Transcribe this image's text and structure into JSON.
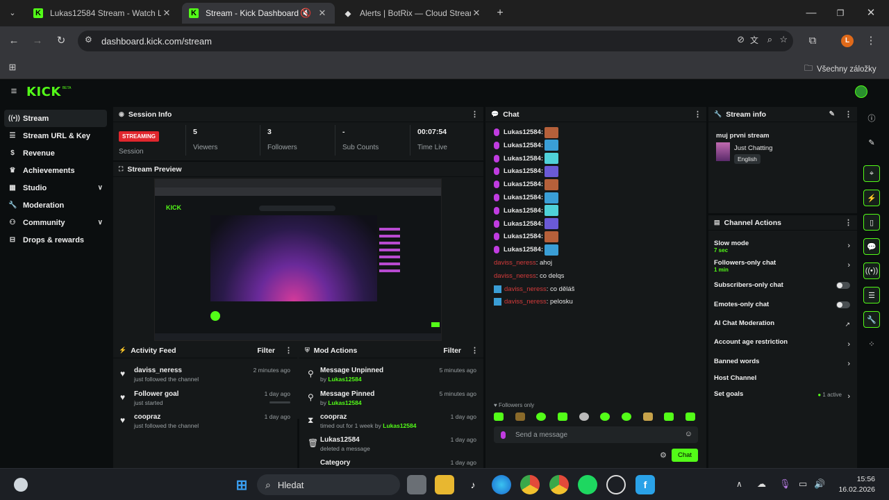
{
  "browser": {
    "tabs": [
      {
        "title": "Lukas12584 Stream - Watch Live",
        "active": false
      },
      {
        "title": "Stream - Kick Dashboard",
        "active": true
      },
      {
        "title": "Alerts | BotRix — Cloud Stream",
        "active": false
      }
    ],
    "url": "dashboard.kick.com/stream",
    "bookmarks_label": "Všechny záložky",
    "profile_initial": "L"
  },
  "app": {
    "logo": "KICK",
    "logo_sup": "BETA",
    "sidebar": [
      {
        "label": "Stream",
        "icon": "broadcast-icon",
        "active": true
      },
      {
        "label": "Stream URL & Key",
        "icon": "database-icon"
      },
      {
        "label": "Revenue",
        "icon": "money-icon"
      },
      {
        "label": "Achievements",
        "icon": "trophy-icon"
      },
      {
        "label": "Studio",
        "icon": "grid-icon",
        "expandable": true
      },
      {
        "label": "Moderation",
        "icon": "wrench-icon"
      },
      {
        "label": "Community",
        "icon": "people-icon",
        "expandable": true
      },
      {
        "label": "Drops & rewards",
        "icon": "gift-icon"
      }
    ],
    "session_info": {
      "title": "Session Info",
      "status_badge": "STREAMING",
      "session_label": "Session",
      "stats": [
        {
          "value": "5",
          "label": "Viewers"
        },
        {
          "value": "3",
          "label": "Followers"
        },
        {
          "value": "-",
          "label": "Sub Counts"
        },
        {
          "value": "00:07:54",
          "label": "Time Live"
        }
      ]
    },
    "stream_preview": {
      "title": "Stream Preview"
    },
    "activity_feed": {
      "title": "Activity Feed",
      "filter": "Filter",
      "items": [
        {
          "title": "daviss_neress",
          "subtitle": "just followed the channel",
          "time": "2 minutes ago",
          "icon": "heart-icon"
        },
        {
          "title": "Follower goal",
          "subtitle": "just started",
          "time": "1 day ago",
          "icon": "heart-icon"
        },
        {
          "title": "coopraz",
          "subtitle": "just followed the channel",
          "time": "1 day ago",
          "icon": "heart-icon"
        }
      ]
    },
    "mod_actions": {
      "title": "Mod Actions",
      "filter": "Filter",
      "items": [
        {
          "title": "Message Unpinned",
          "prefix": "by",
          "user": "Lukas12584",
          "time": "5 minutes ago",
          "icon": "unpin-icon"
        },
        {
          "title": "Message Pinned",
          "prefix": "by",
          "user": "Lukas12584",
          "time": "5 minutes ago",
          "icon": "pin-icon"
        },
        {
          "title": "coopraz",
          "prefix": "timed out for 1 week by",
          "user": "Lukas12584",
          "time": "1 day ago",
          "icon": "hourglass-icon"
        },
        {
          "title": "Lukas12584",
          "prefix": "deleted a message",
          "user": "",
          "time": "1 day ago",
          "icon": "trash-icon"
        },
        {
          "title": "Category",
          "prefix": "",
          "user": "",
          "time": "1 day ago",
          "icon": ""
        }
      ]
    },
    "chat": {
      "title": "Chat",
      "messages": [
        {
          "user": "Lukas12584:",
          "text": "",
          "emote": "#b5603a"
        },
        {
          "user": "Lukas12584:",
          "text": "",
          "emote": "#3a9ed6"
        },
        {
          "user": "Lukas12584:",
          "text": "",
          "emote": "#4fd1d9"
        },
        {
          "user": "Lukas12584:",
          "text": "",
          "emote": "#6a5ad6"
        },
        {
          "user": "Lukas12584:",
          "text": "",
          "emote": "#b5603a"
        },
        {
          "user": "Lukas12584:",
          "text": "",
          "emote": "#3a9ed6"
        },
        {
          "user": "Lukas12584:",
          "text": "",
          "emote": "#4fd1d9"
        },
        {
          "user": "Lukas12584:",
          "text": "",
          "emote": "#6a5ad6"
        },
        {
          "user": "Lukas12584:",
          "text": "",
          "emote": "#b5603a"
        },
        {
          "user": "Lukas12584:",
          "text": "",
          "emote": "#3a9ed6"
        },
        {
          "user": "daviss_neress",
          "text": ": ahoj",
          "emote": ""
        },
        {
          "user": "daviss_neress",
          "text": ": co delqs",
          "emote": ""
        },
        {
          "user": "daviss_neress",
          "text": ": co děláš",
          "emote": ""
        },
        {
          "user": "daviss_neress",
          "text": ": pelosku",
          "emote": ""
        }
      ],
      "followers_only": "Followers only",
      "input_placeholder": "Send a message",
      "send_button": "Chat"
    },
    "stream_info": {
      "title": "Stream info",
      "stream_title": "muj prvni stream",
      "category": "Just Chatting",
      "language": "English"
    },
    "channel_actions": {
      "title": "Channel Actions",
      "items": [
        {
          "label": "Slow mode",
          "sub": "7 sec",
          "control": "chevron"
        },
        {
          "label": "Followers-only chat",
          "sub": "1 min",
          "control": "chevron"
        },
        {
          "label": "Subscribers-only chat",
          "sub": "",
          "control": "toggle"
        },
        {
          "label": "Emotes-only chat",
          "sub": "",
          "control": "toggle"
        },
        {
          "label": "AI Chat Moderation",
          "sub": "",
          "control": "external"
        },
        {
          "label": "Account age restriction",
          "sub": "",
          "control": "chevron"
        },
        {
          "label": "Banned words",
          "sub": "",
          "control": "chevron"
        },
        {
          "label": "Host Channel",
          "sub": "",
          "control": "none"
        },
        {
          "label": "Set goals",
          "sub": "",
          "control": "chevron",
          "status": "1 active"
        }
      ]
    }
  },
  "taskbar": {
    "search_label": "Hledat",
    "time": "15:56",
    "date": "16.02.2026"
  },
  "colors": {
    "kick_green": "#53fc18",
    "streaming_red": "#e0262d",
    "panel_bg": "#151819"
  }
}
